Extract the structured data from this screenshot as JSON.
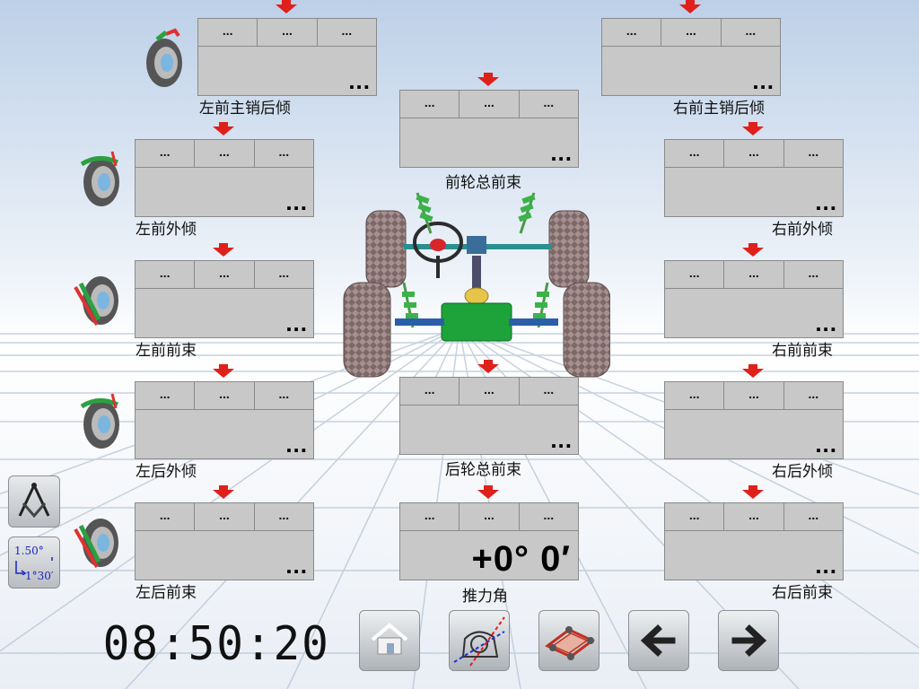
{
  "panels": [
    {
      "id": "lf-caster",
      "cells": [
        "...",
        "...",
        "..."
      ],
      "value": "...",
      "label": "左前主销后倾"
    },
    {
      "id": "rf-caster",
      "cells": [
        "...",
        "...",
        "..."
      ],
      "value": "...",
      "label": "右前主销后倾"
    },
    {
      "id": "front-total-toe",
      "cells": [
        "...",
        "...",
        "..."
      ],
      "value": "...",
      "label": "前轮总前束"
    },
    {
      "id": "lf-camber",
      "cells": [
        "...",
        "...",
        "..."
      ],
      "value": "...",
      "label": "左前外倾"
    },
    {
      "id": "rf-camber",
      "cells": [
        "...",
        "...",
        "..."
      ],
      "value": "...",
      "label": "右前外倾"
    },
    {
      "id": "lf-toe",
      "cells": [
        "...",
        "...",
        "..."
      ],
      "value": "...",
      "label": "左前前束"
    },
    {
      "id": "rf-toe",
      "cells": [
        "...",
        "...",
        "..."
      ],
      "value": "...",
      "label": "右前前束"
    },
    {
      "id": "rear-total-toe",
      "cells": [
        "...",
        "...",
        "..."
      ],
      "value": "...",
      "label": "后轮总前束"
    },
    {
      "id": "lr-camber",
      "cells": [
        "...",
        "...",
        "..."
      ],
      "value": "...",
      "label": "左后外倾"
    },
    {
      "id": "rr-camber",
      "cells": [
        "...",
        "...",
        "..."
      ],
      "value": "...",
      "label": "右后外倾"
    },
    {
      "id": "lr-toe",
      "cells": [
        "...",
        "...",
        "..."
      ],
      "value": "...",
      "label": "左后前束"
    },
    {
      "id": "thrust-angle",
      "cells": [
        "...",
        "...",
        "..."
      ],
      "value": "+0° 0′",
      "label": "推力角"
    },
    {
      "id": "rr-toe",
      "cells": [
        "...",
        "...",
        "..."
      ],
      "value": "...",
      "label": "右后前束"
    }
  ],
  "clock": "08:50:20",
  "unit_toggle": {
    "top": "1.50°",
    "bottom": "1°30′"
  },
  "icons": {
    "arrow": "red-down-arrow-icon",
    "wheel": "wheel-angle-icon",
    "unit-mm": "unit-mm-icon",
    "home": "home-icon",
    "steer": "steering-measure-icon",
    "car": "car-chassis-icon",
    "back": "arrow-left-icon",
    "forward": "arrow-right-icon"
  },
  "colors": {
    "panel": "#c8c8c8",
    "arrow": "#e0201b",
    "background": "#dfe7f2"
  }
}
